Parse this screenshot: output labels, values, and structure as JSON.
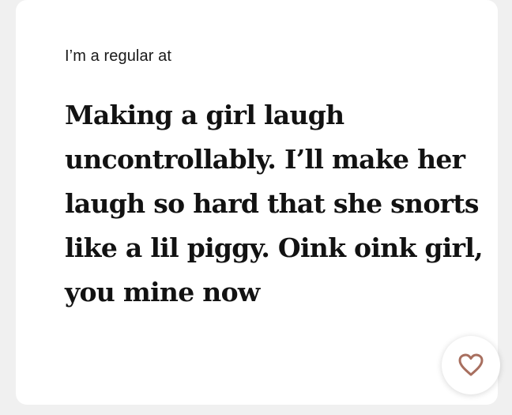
{
  "card": {
    "prompt": "I’m a regular at",
    "answer": "Making a girl laugh uncontrollably. I’ll make her laugh so hard that she snorts like a lil piggy. Oink oink girl, you mine now",
    "like_icon": "heart-icon",
    "colors": {
      "background": "#f0f0f0",
      "card": "#ffffff",
      "text": "#121212",
      "heart": "#a86f5f"
    }
  }
}
